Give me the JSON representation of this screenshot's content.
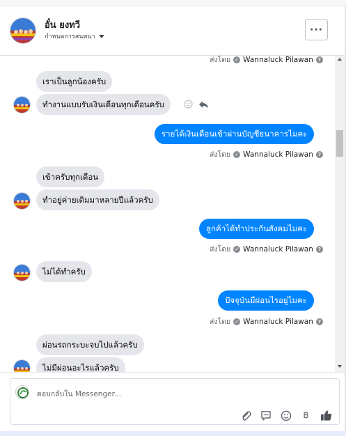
{
  "header": {
    "name": "อั๋น ยงทวี",
    "subtitle": "กำหนดการสนทนา",
    "more_label": "···"
  },
  "sent_by": {
    "prefix": "ส่งโดย",
    "sender": "Wannaluck Pilawan",
    "help_glyph": "?"
  },
  "messages": [
    {
      "dir": "in",
      "text": "เราเป็นลูกน้องครับ"
    },
    {
      "dir": "in",
      "text": "ทำงานแบบรับเงินเดือนทุกเดือนครับ",
      "avatar": true
    },
    {
      "dir": "out",
      "text": "รายได้เงินเดือนเข้าผ่านบัญชีธนาคารไมคะ"
    },
    {
      "dir": "in",
      "text": "เข้าครับทุกเดือน"
    },
    {
      "dir": "in",
      "text": "ทำอยู่ค่ายเดิมมาหลายปีแล้วครับ",
      "avatar": true
    },
    {
      "dir": "out",
      "text": "ลูกค้าได้ทำประกันสังคมไมคะ"
    },
    {
      "dir": "in",
      "text": "ไม่ได้ทำครับ",
      "avatar": true
    },
    {
      "dir": "out",
      "text": "ปัจจุบันมีผ่อนไรอยู่ไมคะ"
    },
    {
      "dir": "in",
      "text": "ผ่อนรถกระบะจบไปแล้วครับ"
    },
    {
      "dir": "in",
      "text": "ไม่มีผ่อนอะไรแล้วครับ",
      "avatar": true
    }
  ],
  "composer": {
    "placeholder": "ตอบกลับใน Messenger..."
  },
  "icons": {
    "attach": "paperclip-icon",
    "saved_reply": "saved-replies-icon",
    "emoji": "emoji-icon",
    "baht": "฿",
    "like": "thumbs-up-icon"
  },
  "colors": {
    "outgoing_bubble": "#0084ff",
    "incoming_bubble": "#e4e6eb"
  }
}
